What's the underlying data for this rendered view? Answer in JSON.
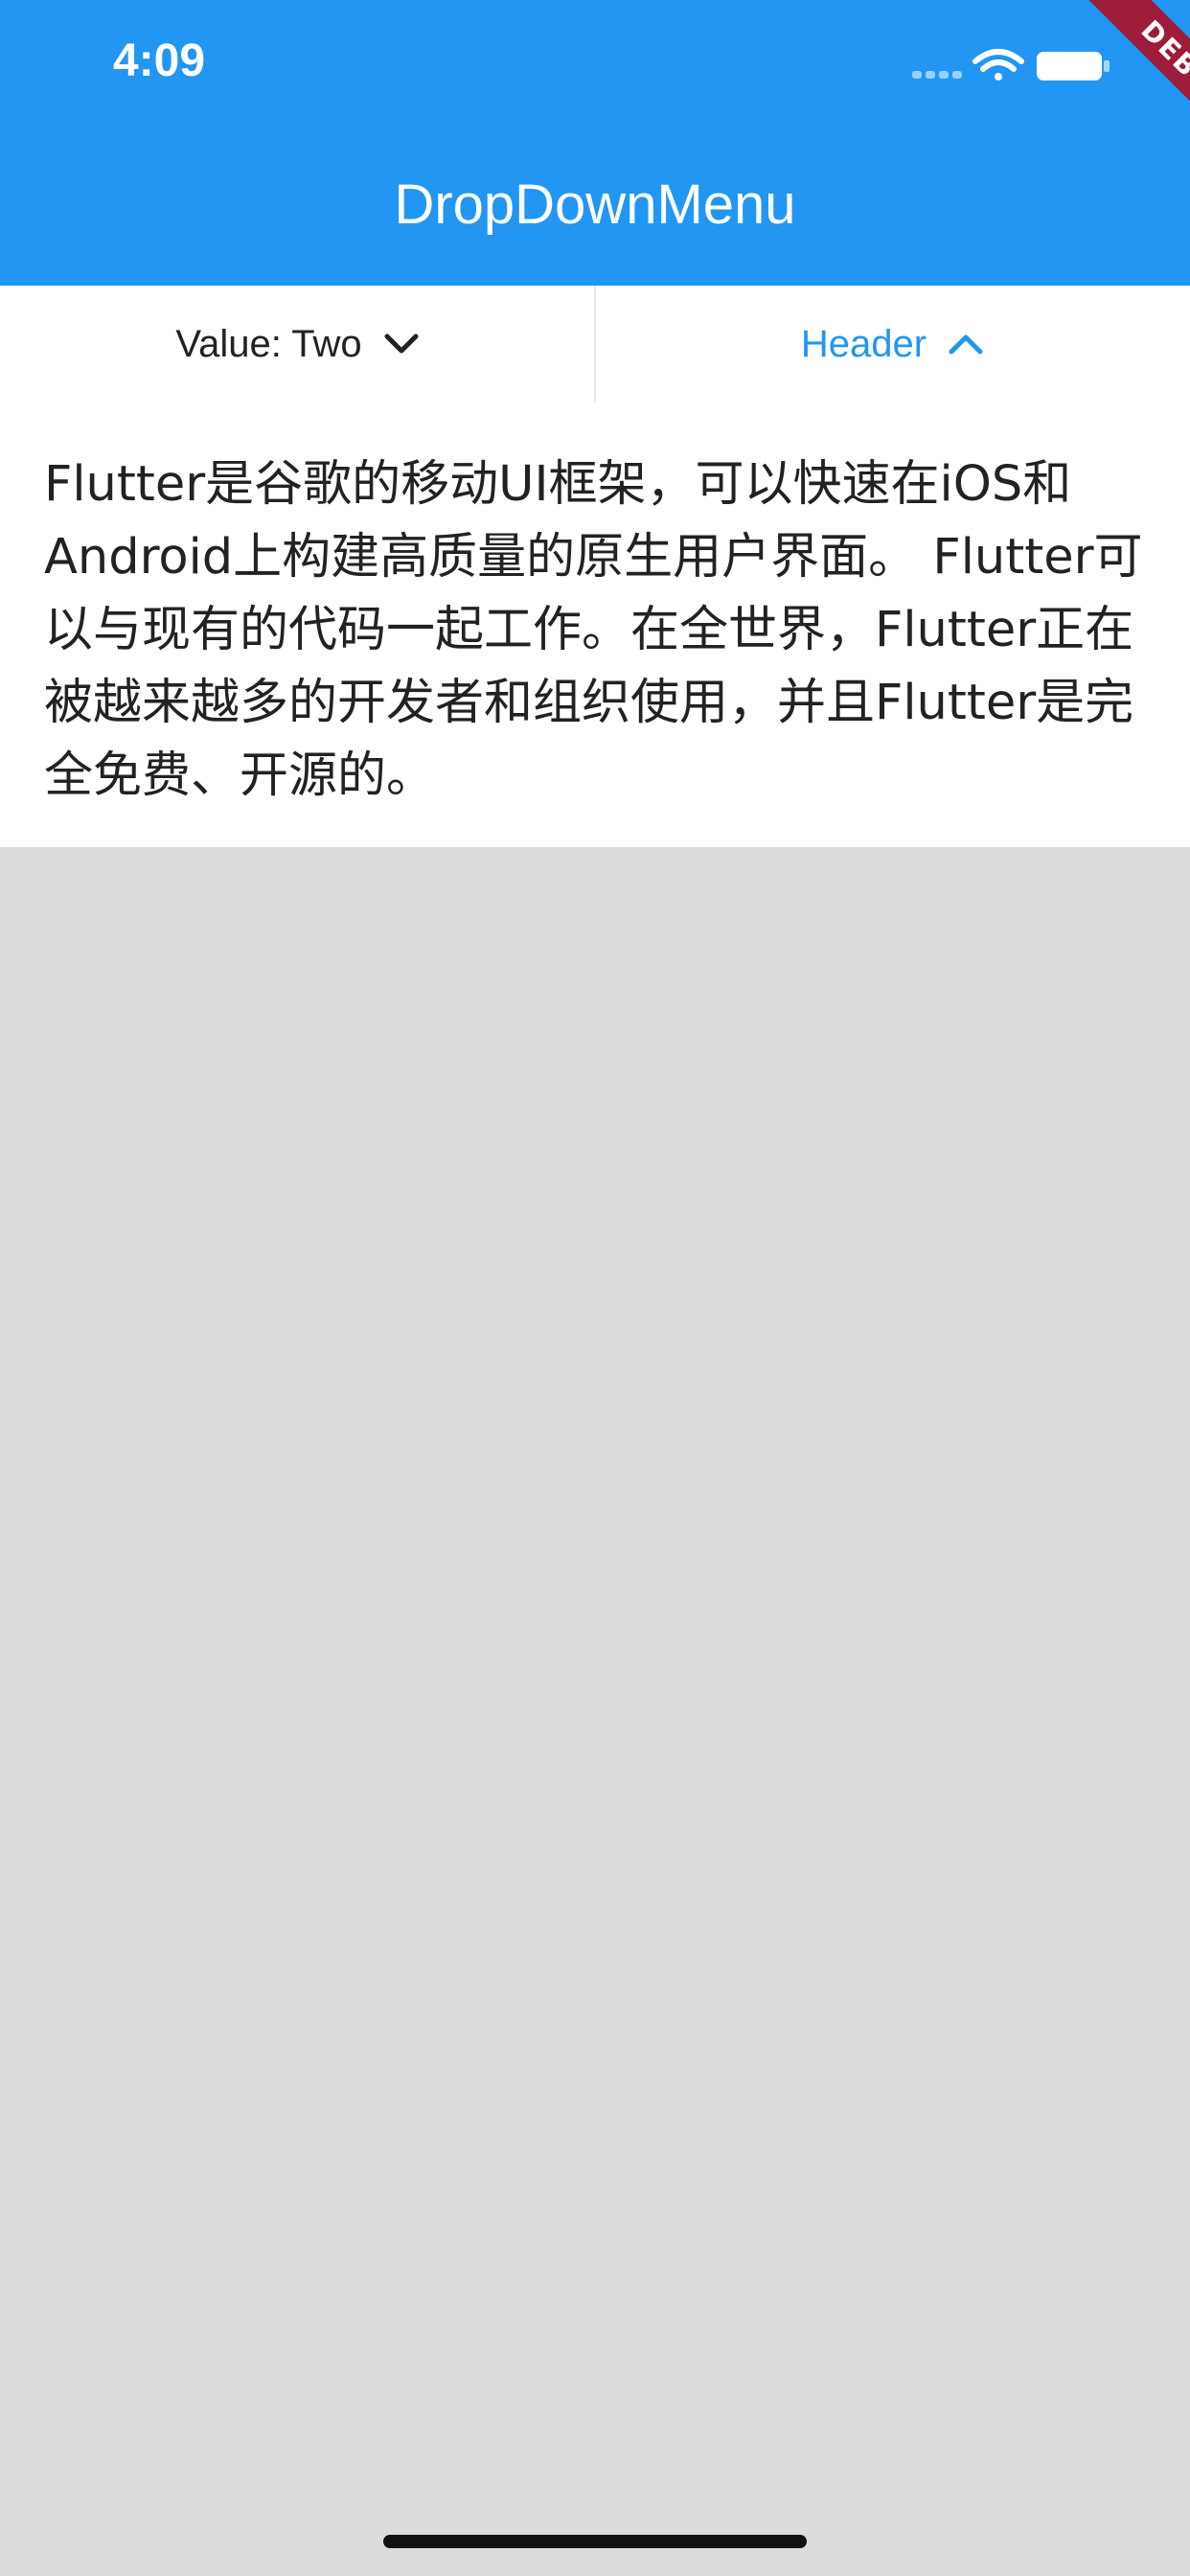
{
  "status_bar": {
    "time": "4:09"
  },
  "debug_banner": {
    "label": "DEBUG"
  },
  "app_bar": {
    "title": "DropDownMenu"
  },
  "menu_tabs": [
    {
      "label": "Value: Two",
      "icon": "chevron-down-icon",
      "active": false
    },
    {
      "label": "Header",
      "icon": "chevron-up-icon",
      "active": true
    }
  ],
  "content": {
    "text": "Flutter是谷歌的移动UI框架，可以快速在iOS和Android上构建高质量的原生用户界面。 Flutter可以与现有的代码一起工作。在全世界，Flutter正在被越来越多的开发者和组织使用，并且Flutter是完全免费、开源的。"
  },
  "colors": {
    "primary": "#2196f3",
    "overlay": "#dcdcdc",
    "debug": "#9e1b3a"
  }
}
